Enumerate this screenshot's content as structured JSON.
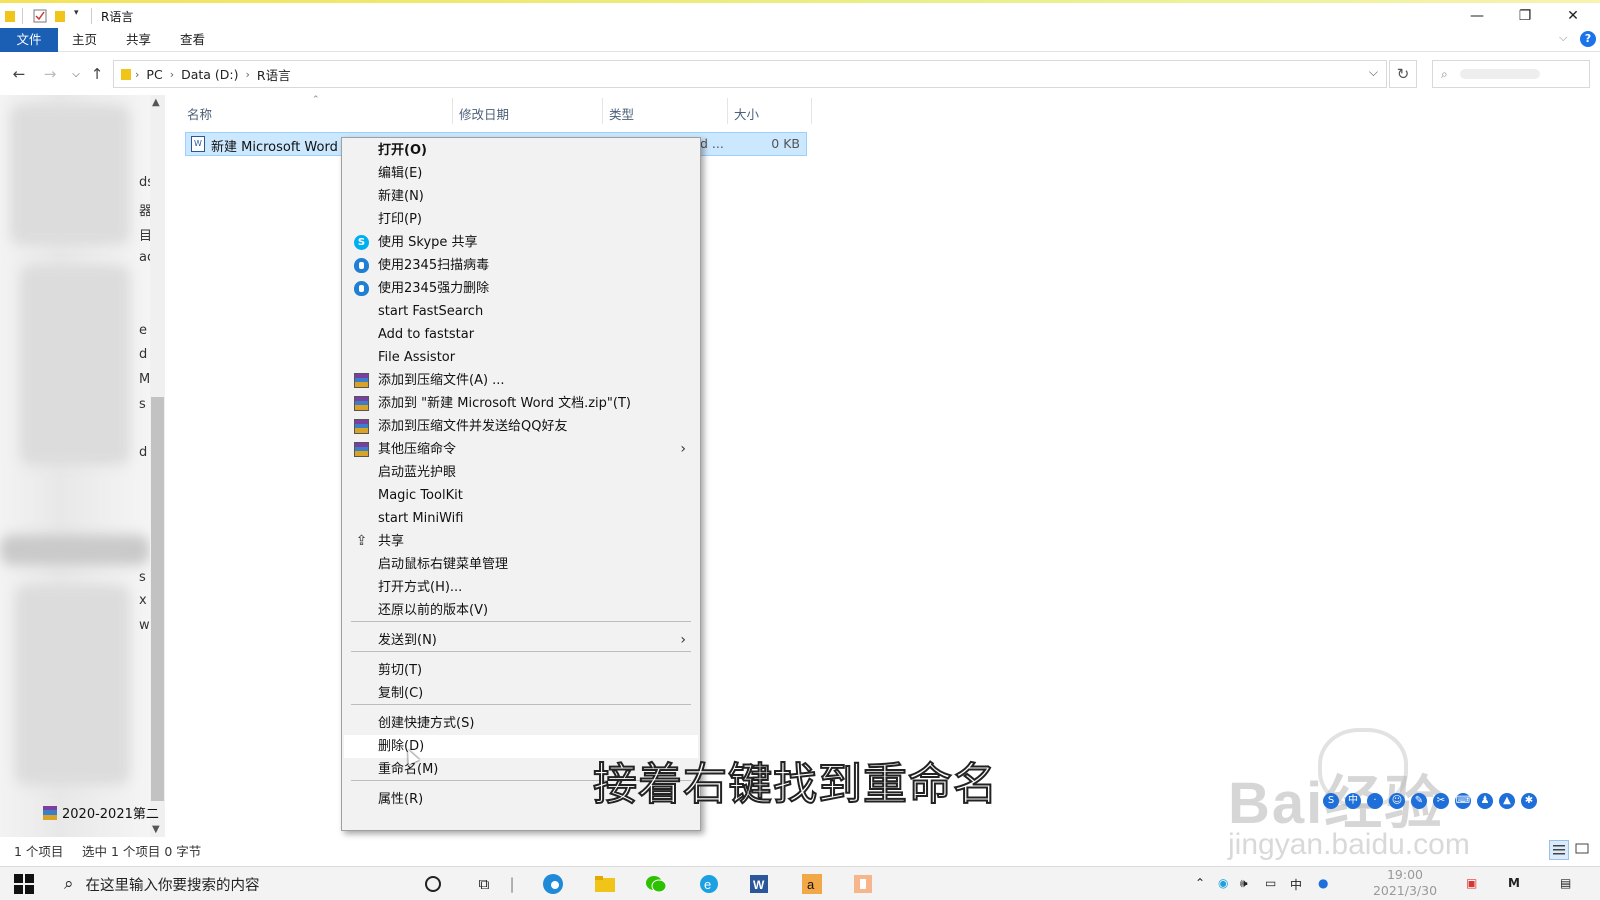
{
  "window": {
    "title": "R语言",
    "controls": {
      "minimize": "—",
      "restore": "❐",
      "close": "✕"
    }
  },
  "ribbon": {
    "tabs": [
      "文件",
      "主页",
      "共享",
      "查看"
    ],
    "help": "?"
  },
  "address": {
    "crumbs": [
      "PC",
      "Data (D:)",
      "R语言"
    ]
  },
  "columns": {
    "name": "名称",
    "modified": "修改日期",
    "type": "类型",
    "size": "大小"
  },
  "file": {
    "name": "新建 Microsoft Word 文",
    "type_fragment": "d ...",
    "size": "0 KB"
  },
  "nav_pane": {
    "fragments": [
      "ds",
      "器",
      "目",
      "ac",
      "e",
      "d",
      "Ma",
      "s",
      "d",
      "s",
      "x",
      "w"
    ],
    "folder_label": "2020-2021第二"
  },
  "context_menu": {
    "items": [
      {
        "label": "打开(O)",
        "bold": true
      },
      {
        "label": "编辑(E)"
      },
      {
        "label": "新建(N)"
      },
      {
        "label": "打印(P)"
      },
      {
        "label": "使用 Skype 共享",
        "icon": "skype-icon"
      },
      {
        "label": "使用2345扫描病毒",
        "icon": "shield-icon"
      },
      {
        "label": "使用2345强力删除",
        "icon": "shield-icon"
      },
      {
        "label": "start FastSearch"
      },
      {
        "label": "Add to faststar"
      },
      {
        "label": "File Assistor"
      },
      {
        "label": "添加到压缩文件(A) ...",
        "icon": "winrar-icon"
      },
      {
        "label": "添加到 \"新建 Microsoft Word 文档.zip\"(T)",
        "icon": "winrar-icon"
      },
      {
        "label": "添加到压缩文件并发送给QQ好友",
        "icon": "winrar-icon"
      },
      {
        "label": "其他压缩命令",
        "icon": "winrar-icon",
        "submenu": true
      },
      {
        "label": "启动蓝光护眼"
      },
      {
        "label": "Magic ToolKit"
      },
      {
        "label": "start MiniWifi"
      },
      {
        "label": "共享",
        "icon": "share-icon"
      },
      {
        "label": "启动鼠标右键菜单管理"
      },
      {
        "label": "打开方式(H)..."
      },
      {
        "label": "还原以前的版本(V)"
      },
      {
        "label": "发送到(N)",
        "submenu": true
      },
      {
        "label": "剪切(T)"
      },
      {
        "label": "复制(C)"
      },
      {
        "label": "创建快捷方式(S)"
      },
      {
        "label": "删除(D)",
        "highlighted": true
      },
      {
        "label": "重命名(M)"
      },
      {
        "label": "属性(R)"
      }
    ]
  },
  "status": {
    "count": "1 个项目",
    "selected": "选中 1 个项目  0 字节"
  },
  "caption": "接着右键找到重命名",
  "watermark": {
    "logo": "Bai经验",
    "url": "jingyan.baidu.com"
  },
  "taskbar": {
    "search_placeholder": "在这里输入你要搜索的内容",
    "time": "19:00",
    "date": "2021/3/30"
  },
  "colors": {
    "accent": "#1a5fb4",
    "selection": "#cce8ff",
    "menu_bg": "#f2f2f2"
  }
}
